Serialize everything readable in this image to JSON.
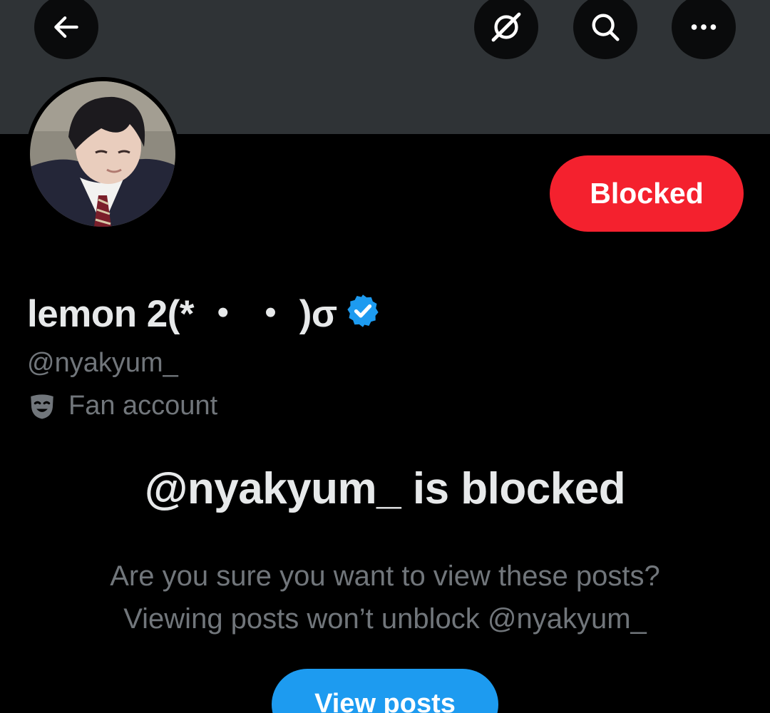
{
  "header": {
    "icons": [
      "arrow-left-icon",
      "grok-icon",
      "search-icon",
      "more-horizontal-icon"
    ]
  },
  "profile": {
    "display_name": "lemon 2(* ・ ・ )σ",
    "handle": "@nyakyum_",
    "category": "Fan account",
    "verified": true,
    "blocked_button_label": "Blocked"
  },
  "blocked_notice": {
    "title": "@nyakyum_ is blocked",
    "line1": "Are you sure you want to view these posts?",
    "line2": "Viewing posts won’t unblock @nyakyum_",
    "view_posts_label": "View posts"
  },
  "colors": {
    "banner": "#2f3336",
    "background": "#000000",
    "blocked_red": "#f4212e",
    "accent_blue": "#1d9bf0",
    "primary_text": "#e7e9ea",
    "secondary_text": "#71767b"
  }
}
